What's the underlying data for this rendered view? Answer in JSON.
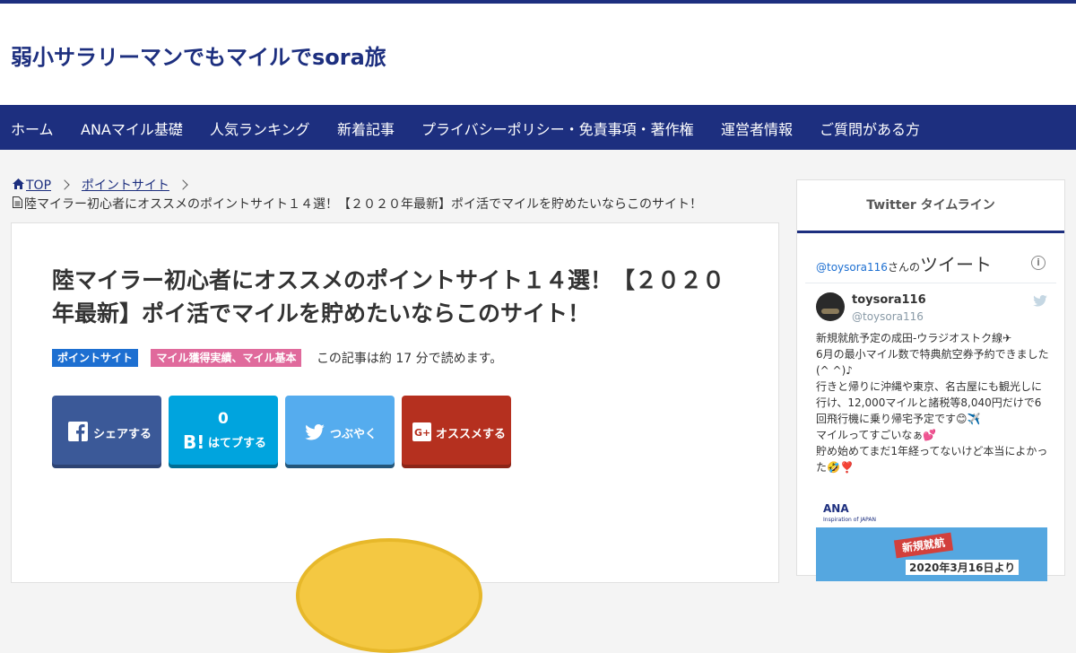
{
  "site": {
    "title": "弱小サラリーマンでもマイルでsora旅"
  },
  "nav": {
    "items": [
      "ホーム",
      "ANAマイル基礎",
      "人気ランキング",
      "新着記事",
      "プライバシーポリシー・免責事項・著作権",
      "運営者情報",
      "ご質問がある方"
    ]
  },
  "breadcrumb": {
    "home": "TOP",
    "category": "ポイントサイト",
    "current": "陸マイラー初心者にオススメのポイントサイト１４選！【２０２０年最新】ポイ活でマイルを貯めたいならこのサイト！"
  },
  "article": {
    "title": "陸マイラー初心者にオススメのポイントサイト１４選！【２０２０年最新】ポイ活でマイルを貯めたいならこのサイト！",
    "categories": [
      "ポイントサイト",
      "マイル獲得実績、マイル基本"
    ],
    "read_time": "この記事は約 17 分で読めます。"
  },
  "share": {
    "facebook": "シェアする",
    "hatena_count": "0",
    "hatena": "はてブする",
    "twitter": "つぶやく",
    "google": "オススメする"
  },
  "sidebar": {
    "widget_title": "Twitter タイムライン",
    "timeline_prefix": "@toysora116",
    "timeline_suffix": "さんの",
    "timeline_word": "ツイート",
    "user_name": "toysora116",
    "user_handle": "@toysora116",
    "tweet_lines": [
      "新規就航予定の成田-ウラジオストク線✈",
      "6月の最小マイル数で特典航空券予約できました(^ ^)♪",
      "行きと帰りに沖縄や東京、名古屋にも観光しに行け、12,000マイルと諸税等8,040円だけで6回飛行機に乗り帰宅予定です😊✈️",
      "マイルってすごいなぁ💕",
      "貯め始めてまだ1年経ってないけど本当によかった🤣❣️"
    ],
    "ad": {
      "logo": "ANA",
      "logo_sub": "Inspiration of JAPAN",
      "tag": "新規就航",
      "date": "2020年3月16日より"
    }
  },
  "colors": {
    "brand": "#1d2f7f",
    "facebook": "#3b5998",
    "hatena": "#00a4de",
    "twitter": "#55acee",
    "google": "#b5301f"
  }
}
